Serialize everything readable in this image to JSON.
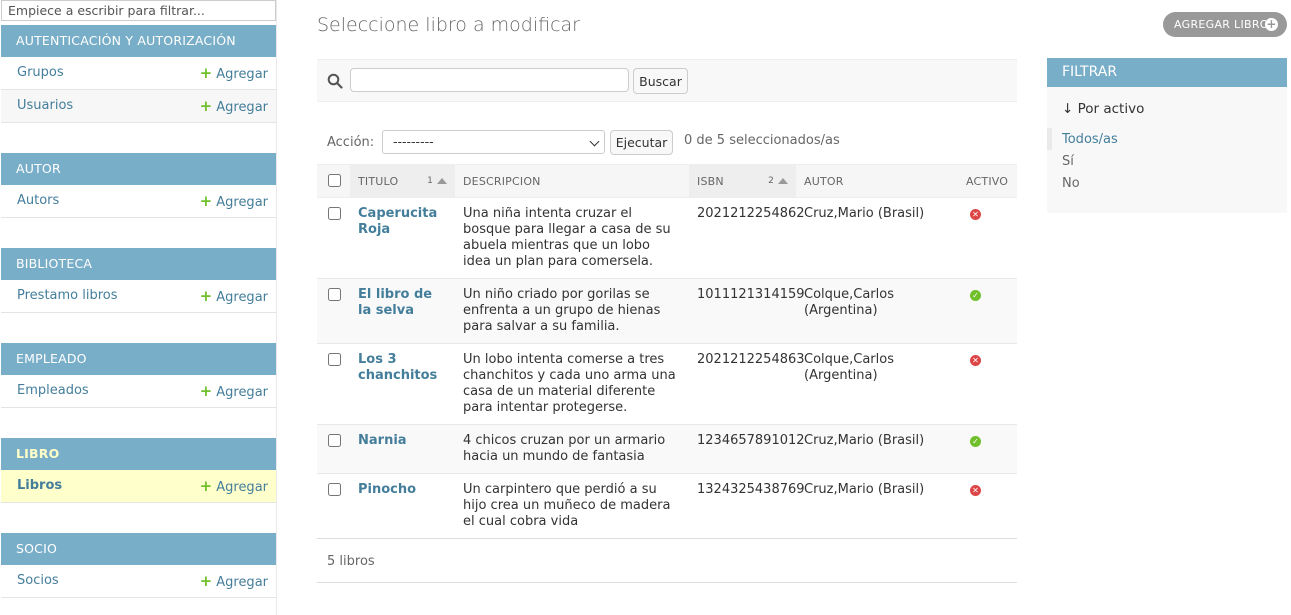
{
  "sidebar": {
    "filter_placeholder": "Empiece a escribir para filtrar...",
    "add_label": "Agregar",
    "modules": [
      {
        "caption": "AUTENTICACIÓN Y AUTORIZACIÓN",
        "models": [
          "Grupos",
          "Usuarios"
        ]
      },
      {
        "caption": "AUTOR",
        "models": [
          "Autors"
        ]
      },
      {
        "caption": "BIBLIOTECA",
        "models": [
          "Prestamo libros"
        ]
      },
      {
        "caption": "EMPLEADO",
        "models": [
          "Empleados"
        ]
      },
      {
        "caption": "LIBRO",
        "models": [
          "Libros"
        ],
        "current": true
      },
      {
        "caption": "SOCIO",
        "models": [
          "Socios"
        ]
      }
    ]
  },
  "header": {
    "title": "Seleccione libro a modificar",
    "add_button": "AGREGAR LIBRO",
    "add_icon": "+"
  },
  "search": {
    "button": "Buscar",
    "value": ""
  },
  "actions": {
    "label": "Acción:",
    "selected": "---------",
    "run_button": "Ejecutar",
    "counter": "0 de 5 seleccionados/as"
  },
  "table": {
    "columns": {
      "titulo": "TITULO",
      "titulo_sort": "1",
      "descripcion": "DESCRIPCION",
      "isbn": "ISBN",
      "isbn_sort": "2",
      "autor": "AUTOR",
      "activo": "ACTIVO"
    },
    "rows": [
      {
        "title": "Caperucita Roja",
        "description": "Una niña intenta cruzar el bosque para llegar a casa de su abuela mientras que un lobo idea un plan para comersela.",
        "isbn": "2021212254862",
        "author": "Cruz,Mario (Brasil)",
        "active": false
      },
      {
        "title": "El libro de la selva",
        "description": "Un niño criado por gorilas se enfrenta a un grupo de hienas para salvar a su familia.",
        "isbn": "1011121314159",
        "author": "Colque,Carlos (Argentina)",
        "active": true
      },
      {
        "title": "Los 3 chanchitos",
        "description": "Un lobo intenta comerse a tres chanchitos y cada uno arma una casa de un material diferente para intentar protegerse.",
        "isbn": "2021212254863",
        "author": "Colque,Carlos (Argentina)",
        "active": false
      },
      {
        "title": "Narnia",
        "description": "4 chicos cruzan por un armario hacia un mundo de fantasia",
        "isbn": "1234657891012",
        "author": "Cruz,Mario (Brasil)",
        "active": true
      },
      {
        "title": "Pinocho",
        "description": "Un carpintero que perdió a su hijo crea un muñeco de madera el cual cobra vida",
        "isbn": "1324325438769",
        "author": "Cruz,Mario (Brasil)",
        "active": false
      }
    ],
    "footer": "5 libros"
  },
  "filter": {
    "title": "FILTRAR",
    "heading": "↓ Por activo",
    "options": [
      "Todos/as",
      "Sí",
      "No"
    ],
    "selected_index": 0
  },
  "colors": {
    "module_header": "#79aec8",
    "link": "#447e9b",
    "add_green": "#70bf2b",
    "current_row": "#ffffcc",
    "error_red": "#dd4646"
  },
  "icons": {
    "search": "search-icon",
    "yes": "check-circle-icon",
    "no": "x-circle-icon",
    "add": "plus-icon"
  }
}
